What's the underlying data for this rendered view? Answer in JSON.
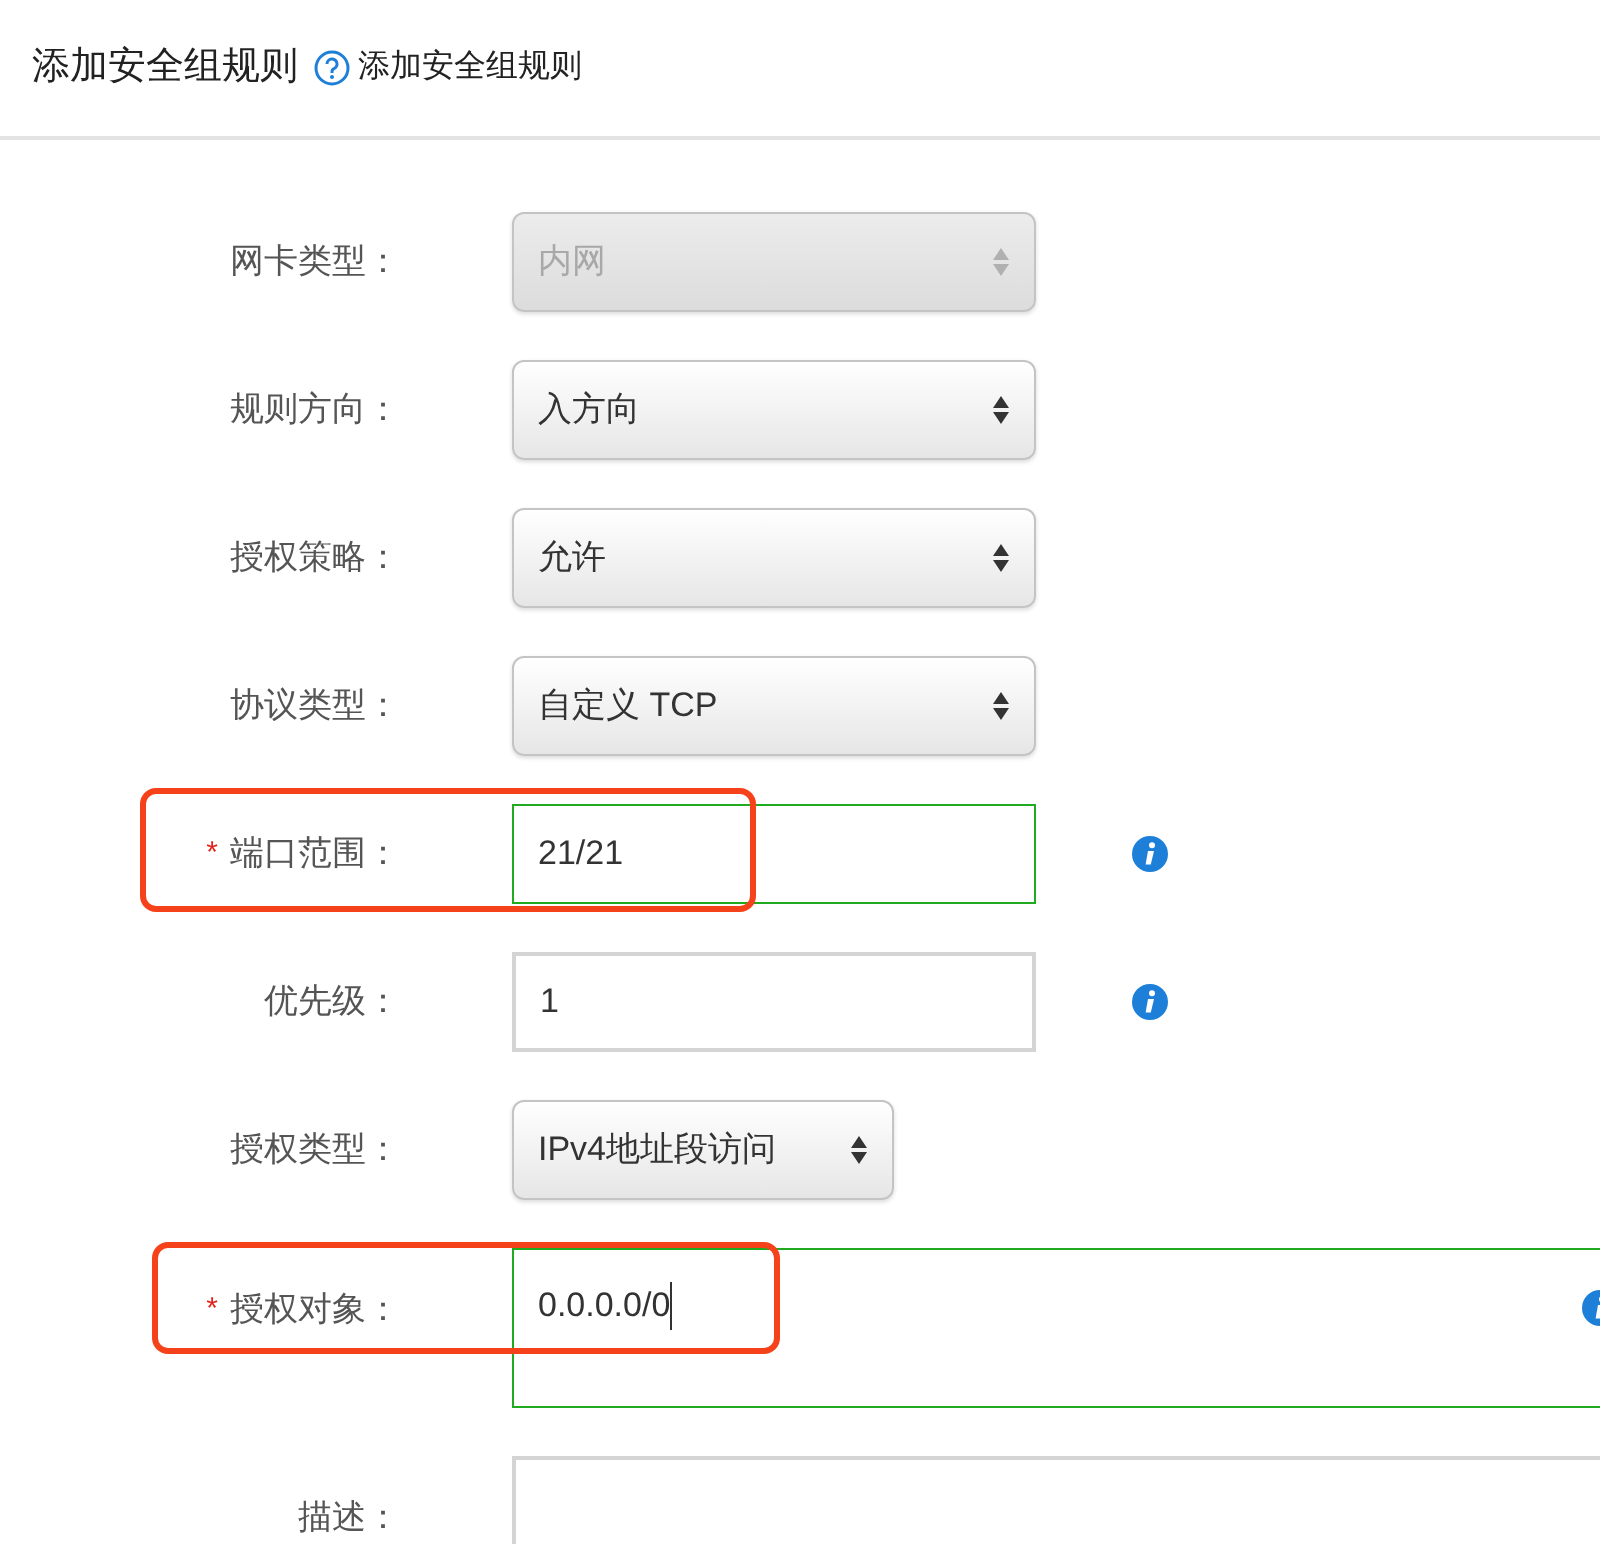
{
  "header": {
    "title": "添加安全组规则",
    "help_text": "添加安全组规则"
  },
  "fields": [
    {
      "label": "网卡类型：",
      "kind": "select",
      "value": "内网",
      "disabled": true,
      "compact": false
    },
    {
      "label": "规则方向：",
      "kind": "select",
      "value": "入方向",
      "disabled": false,
      "compact": false
    },
    {
      "label": "授权策略：",
      "kind": "select",
      "value": "允许",
      "disabled": false,
      "compact": false
    },
    {
      "label": "协议类型：",
      "kind": "select",
      "value": "自定义 TCP",
      "disabled": false,
      "compact": false
    },
    {
      "required_mark": "*",
      "label": "端口范围：",
      "kind": "input",
      "value": "21/21",
      "valid": true,
      "highlighted": true,
      "info": true
    },
    {
      "label": "优先级：",
      "kind": "input",
      "value": "1",
      "valid": false,
      "info": true
    },
    {
      "label": "授权类型：",
      "kind": "select",
      "value": "IPv4地址段访问",
      "disabled": false,
      "compact": true
    },
    {
      "required_mark": "*",
      "label": "授权对象：",
      "kind": "textarea",
      "value": "0.0.0.0/0",
      "valid": true,
      "focused": true,
      "highlighted": true,
      "info": true
    },
    {
      "label": "描述：",
      "kind": "textarea",
      "valid": false,
      "focused": false
    }
  ]
}
